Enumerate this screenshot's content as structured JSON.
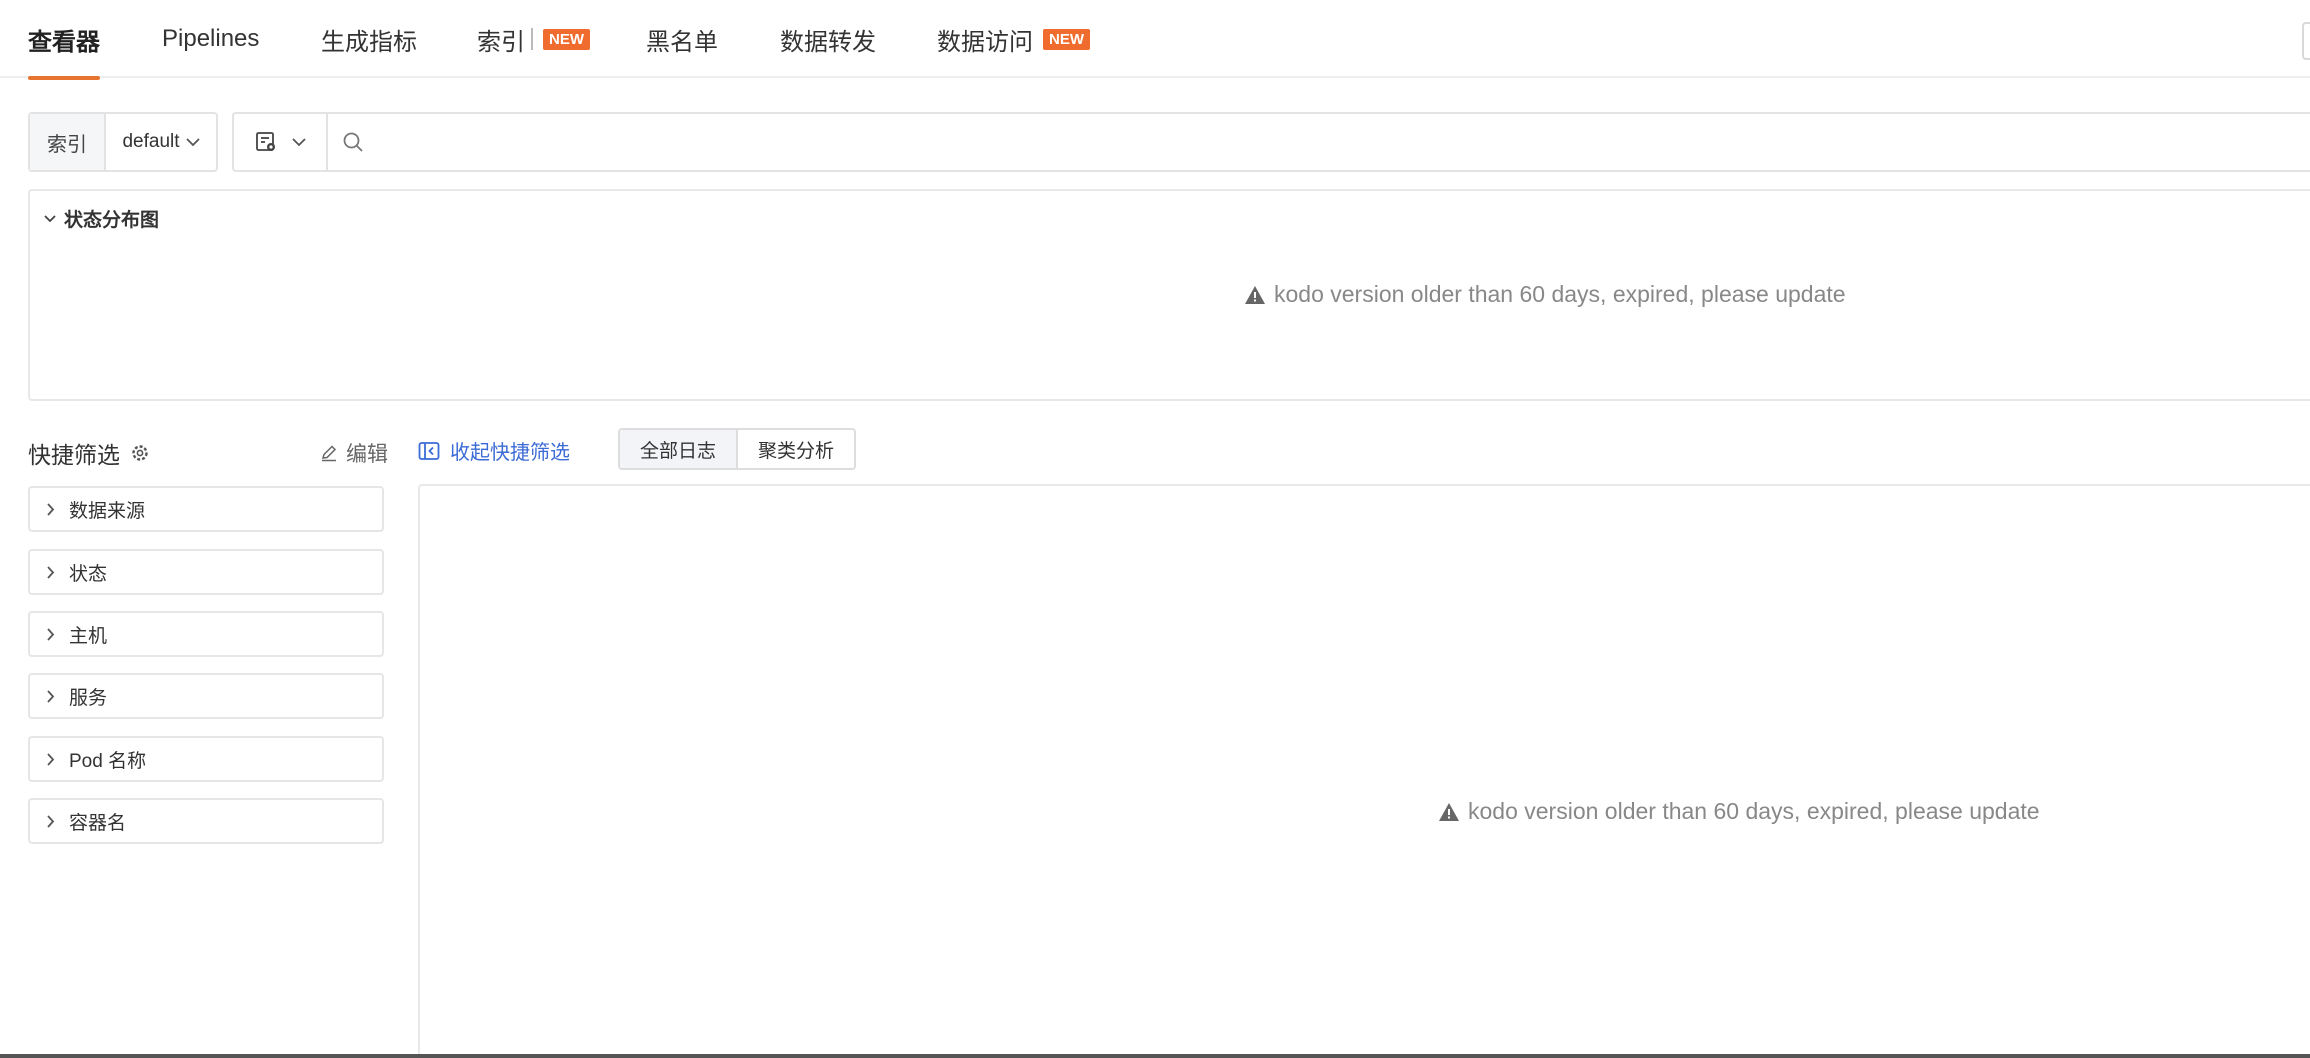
{
  "tabs": [
    {
      "label": "查看器",
      "active": true,
      "badge": ""
    },
    {
      "label": "Pipelines",
      "active": false,
      "badge": ""
    },
    {
      "label": "生成指标",
      "active": false,
      "badge": ""
    },
    {
      "label": "索引",
      "active": false,
      "badge": "NEW"
    },
    {
      "label": "黑名单",
      "active": false,
      "badge": ""
    },
    {
      "label": "数据转发",
      "active": false,
      "badge": ""
    },
    {
      "label": "数据访问",
      "active": false,
      "badge": "NEW"
    }
  ],
  "search": {
    "index_label": "索引",
    "index_value": "default",
    "placeholder": ""
  },
  "status_panel": {
    "title": "状态分布图",
    "message": "kodo version older than 60 days, expired, please update"
  },
  "quick_filter": {
    "title": "快捷筛选",
    "edit_label": "编辑",
    "collapse_label": "收起快捷筛选",
    "items": [
      {
        "label": "数据来源"
      },
      {
        "label": "状态"
      },
      {
        "label": "主机"
      },
      {
        "label": "服务"
      },
      {
        "label": "Pod 名称"
      },
      {
        "label": "容器名"
      }
    ]
  },
  "view_toggle": [
    {
      "label": "全部日志",
      "active": true
    },
    {
      "label": "聚类分析",
      "active": false
    }
  ],
  "log_panel": {
    "message": "kodo version older than 60 days, expired, please update"
  },
  "colors": {
    "accent": "#e8752f",
    "badge": "#ef6c2e",
    "link": "#3b6bd6",
    "muted_text": "#888888"
  }
}
